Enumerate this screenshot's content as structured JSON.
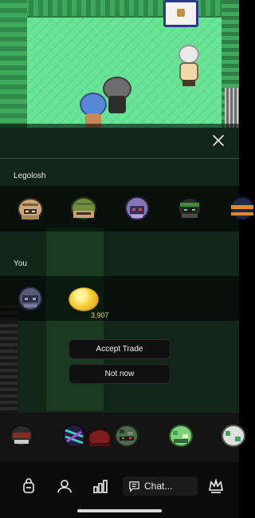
{
  "trade": {
    "partner_name": "Legolosh",
    "you_label": "You",
    "partner_items": [
      {
        "icon": "beige-helmet-icon",
        "color": "#c9a77a"
      },
      {
        "icon": "green-helmet-icon",
        "color": "#6f8f3e"
      },
      {
        "icon": "purple-hood-icon",
        "color": "#8877b5"
      },
      {
        "icon": "green-ninja-mask-icon",
        "color": "#3f8c3a"
      },
      {
        "icon": "orange-navy-helmet-icon",
        "color": "#e08a2a"
      }
    ],
    "your_items": [
      {
        "icon": "dark-hood-icon",
        "color": "#595a78"
      }
    ],
    "coins": {
      "icon": "gold-coin-icon",
      "amount": "3,907"
    },
    "accept_label": "Accept Trade",
    "decline_label": "Not now"
  },
  "inventory": {
    "items": [
      {
        "icon": "red-visor-helmet-icon",
        "color": "#8a2a2a"
      },
      {
        "icon": "neon-helmet-icon",
        "color": "#37d0c8"
      },
      {
        "icon": "red-cap-icon",
        "color": "#7a1f1f"
      },
      {
        "icon": "camo-mask-icon",
        "color": "#4a6a4a"
      },
      {
        "icon": "green-helmet-icon",
        "color": "#7fd27a"
      },
      {
        "icon": "white-green-helmet-icon",
        "color": "#e0e0e0"
      }
    ]
  },
  "nav": {
    "chat_label": "Chat...",
    "icons": [
      "backpack-icon",
      "profile-icon",
      "stats-icon",
      "chat-icon",
      "crown-icon"
    ]
  },
  "colors": {
    "overlay": "#000000",
    "coin_amount": "#f4d44b",
    "button_bg": "#101010"
  }
}
